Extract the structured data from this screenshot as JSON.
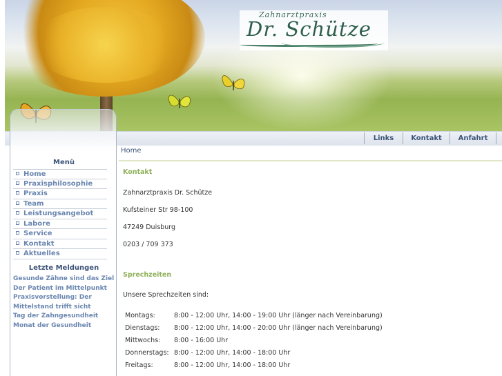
{
  "logo": {
    "small": "Zahnarztpraxis",
    "big": "Dr. Schütze"
  },
  "nav": {
    "links": [
      "Links",
      "Kontakt",
      "Anfahrt"
    ]
  },
  "sidebar": {
    "menu_title": "Menü",
    "menu_items": [
      "Home",
      "Praxisphilosophie",
      "Praxis",
      "Team",
      "Leistungsangebot",
      "Labore",
      "Service",
      "Kontakt",
      "Aktuelles"
    ],
    "news_title": "Letzte Meldungen",
    "news_items": [
      "Gesunde Zähne sind das Ziel",
      "Der Patient im Mittelpunkt",
      "Praxisvorstellung: Der",
      "Mittelstand trifft sicht",
      "Tag der Zahngesundheit",
      "Monat der Gesundheit"
    ]
  },
  "main": {
    "breadcrumb": "Home",
    "contact_title": "Kontakt",
    "address": [
      "Zahnarztpraxis Dr. Schütze",
      "Kufsteiner Str 98-100",
      "47249 Duisburg",
      "0203 / 709 373"
    ],
    "hours_title": "Sprechzeiten",
    "hours_intro": "Unsere Sprechzeiten sind:",
    "hours": [
      {
        "day": "Montags:",
        "time": "8:00 - 12:00 Uhr, 14:00 - 19:00 Uhr  (länger nach Vereinbarung)"
      },
      {
        "day": "Dienstags:",
        "time": "8:00 - 12:00 Uhr, 14:00 - 20:00 Uhr  (länger nach Vereinbarung)"
      },
      {
        "day": "Mittwochs:",
        "time": "8:00 - 16:00 Uhr"
      },
      {
        "day": "Donnerstags:",
        "time": "8:00 - 12:00 Uhr, 14:00 - 18:00 Uhr"
      },
      {
        "day": "Freitags:",
        "time": "8:00 - 12:00 Uhr, 14:00 - 18:00 Uhr"
      }
    ]
  },
  "colors": {
    "nav_text": "#3b5378",
    "menu_text": "#6a86b0",
    "section_title": "#8fb05a"
  }
}
